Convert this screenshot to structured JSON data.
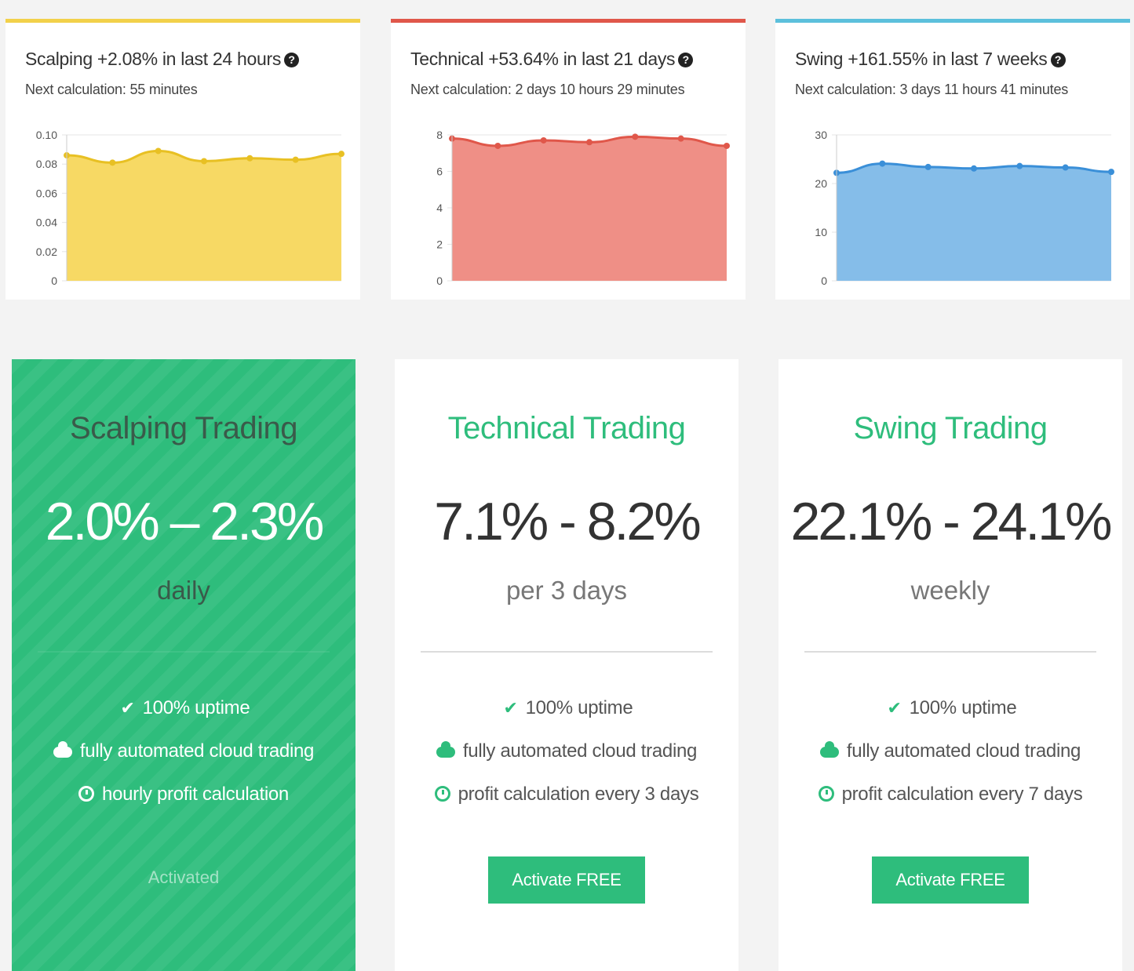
{
  "charts": [
    {
      "title": "Scalping +2.08% in last 24 hours",
      "subtitle": "Next calculation: 55 minutes",
      "accent_color": "#f2d14a",
      "fill_color": "#f7d964",
      "line_color": "#e8c023",
      "chart_data": {
        "type": "area",
        "y_ticks": [
          "0.10",
          "0.08",
          "0.06",
          "0.04",
          "0.02",
          "0"
        ],
        "ylim": [
          0,
          0.1
        ],
        "values": [
          0.086,
          0.081,
          0.089,
          0.082,
          0.084,
          0.083,
          0.087
        ],
        "grid": true
      }
    },
    {
      "title": "Technical +53.64% in last 21 days",
      "subtitle": "Next calculation: 2 days 10 hours 29 minutes",
      "accent_color": "#e0574a",
      "fill_color": "#ef8f86",
      "line_color": "#e0574a",
      "chart_data": {
        "type": "area",
        "y_ticks": [
          "8",
          "6",
          "4",
          "2",
          "0"
        ],
        "ylim": [
          0,
          8
        ],
        "values": [
          7.8,
          7.4,
          7.7,
          7.6,
          7.9,
          7.8,
          7.4
        ],
        "grid": true
      }
    },
    {
      "title": "Swing +161.55% in last 7 weeks",
      "subtitle": "Next calculation: 3 days 11 hours 41 minutes",
      "accent_color": "#5cc0dc",
      "fill_color": "#85bde9",
      "line_color": "#3a8fd8",
      "chart_data": {
        "type": "area",
        "y_ticks": [
          "30",
          "20",
          "10",
          "0"
        ],
        "ylim": [
          0,
          30
        ],
        "values": [
          22.2,
          24.1,
          23.4,
          23.1,
          23.6,
          23.3,
          22.4
        ],
        "grid": true
      }
    }
  ],
  "plans": [
    {
      "name": "Scalping Trading",
      "range": "2.0% – 2.3%",
      "period": "daily",
      "features": [
        {
          "icon": "check-icon",
          "text": "100% uptime"
        },
        {
          "icon": "cloud-icon",
          "text": "fully automated cloud trading"
        },
        {
          "icon": "clock-icon",
          "text": "hourly profit calculation"
        }
      ],
      "status_label": "Activated"
    },
    {
      "name": "Technical Trading",
      "range": "7.1% - 8.2%",
      "period": "per 3 days",
      "features": [
        {
          "icon": "check-icon",
          "text": "100% uptime"
        },
        {
          "icon": "cloud-icon",
          "text": "fully automated cloud trading"
        },
        {
          "icon": "clock-icon",
          "text": "profit calculation every 3 days"
        }
      ],
      "button_label": "Activate FREE"
    },
    {
      "name": "Swing Trading",
      "range": "22.1% - 24.1%",
      "period": "weekly",
      "features": [
        {
          "icon": "check-icon",
          "text": "100% uptime"
        },
        {
          "icon": "cloud-icon",
          "text": "fully automated cloud trading"
        },
        {
          "icon": "clock-icon",
          "text": "profit calculation every 7 days"
        }
      ],
      "button_label": "Activate FREE"
    }
  ],
  "colors": {
    "brand_green": "#2ebd7c"
  }
}
